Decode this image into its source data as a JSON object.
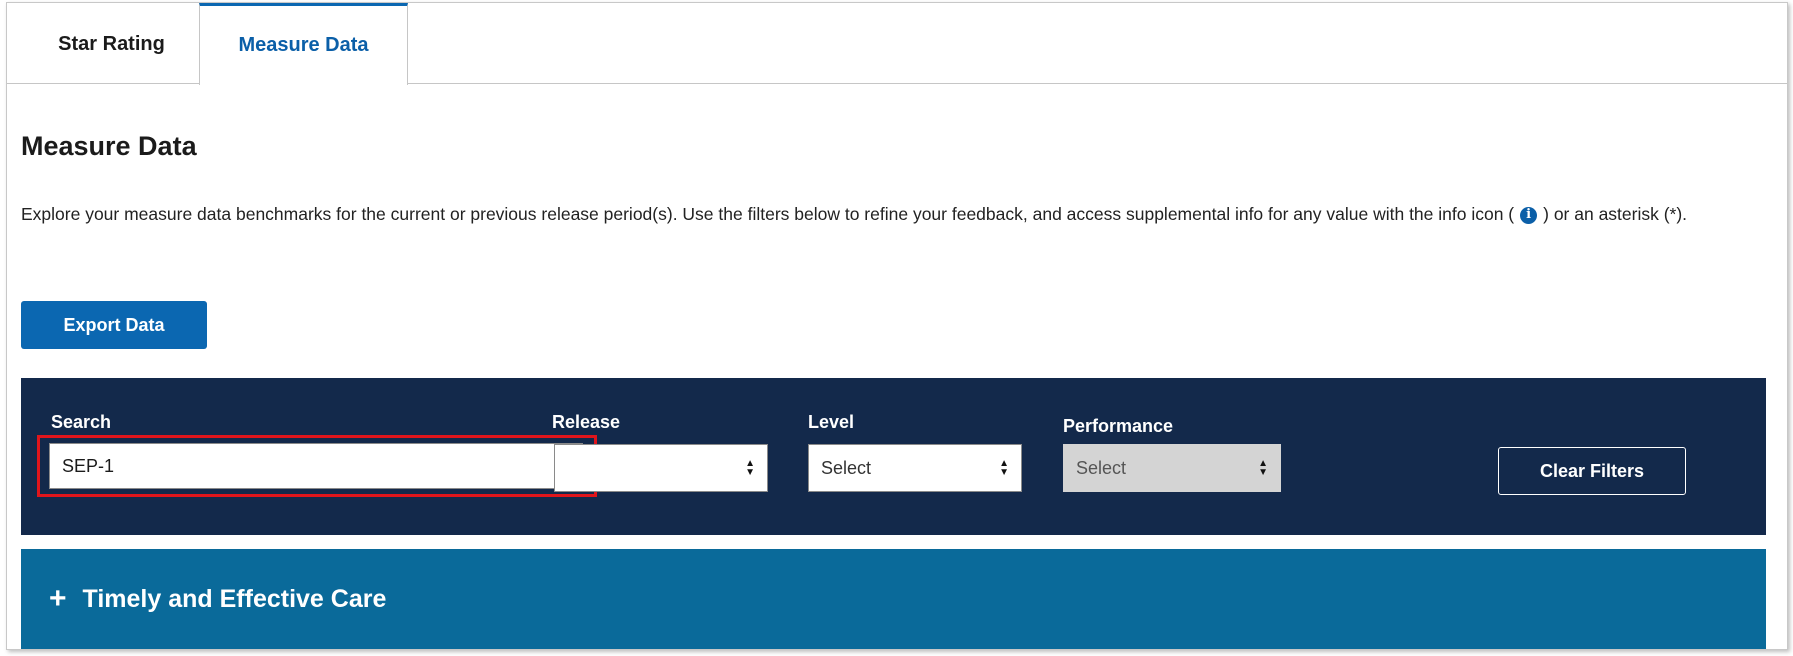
{
  "tabs": [
    {
      "label": "Star Rating",
      "active": false
    },
    {
      "label": "Measure Data",
      "active": true
    }
  ],
  "page": {
    "title": "Measure Data",
    "intro_part1": "Explore your measure data benchmarks for the current or previous release period(s). Use the filters below to refine your feedback, and access supplemental info for any value with the info icon (",
    "intro_part2": ") or an asterisk (*)."
  },
  "export_button": {
    "label": "Export Data"
  },
  "filters": {
    "search": {
      "label": "Search",
      "value": "SEP-1"
    },
    "release": {
      "label": "Release",
      "value": ""
    },
    "level": {
      "label": "Level",
      "value": "Select"
    },
    "performance": {
      "label": "Performance",
      "value": "Select",
      "disabled": true
    },
    "clear_label": "Clear Filters"
  },
  "accordion": {
    "icon": "plus-icon",
    "label": "Timely and Effective Care"
  },
  "colors": {
    "filter_bar": "#13294b",
    "primary_button": "#0b67b1",
    "accordion": "#0a6a9a",
    "highlight": "#e0151b"
  }
}
